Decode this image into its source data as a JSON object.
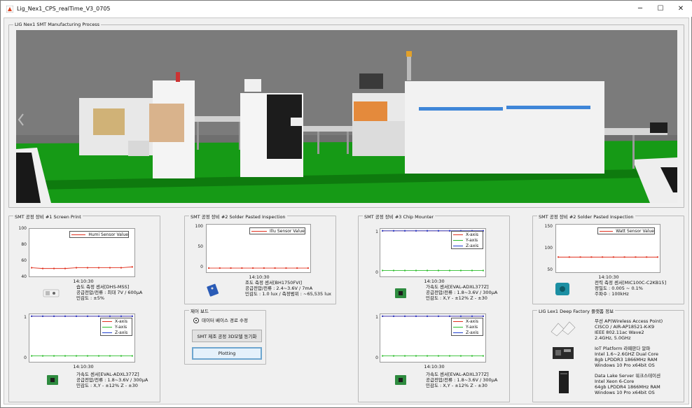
{
  "window": {
    "title": "Lig_Nex1_CPS_realTime_V3_0705",
    "minimize": "─",
    "maximize": "☐",
    "close": "✕"
  },
  "process": {
    "title": "LIG Nex1 SMT Manufacturing Process"
  },
  "panel1": {
    "title": "SMT 공정 장비 #1 Screen Print",
    "chart1": {
      "yticks": [
        "100",
        "80",
        "60",
        "40"
      ],
      "legend": "Humi Sensor Value",
      "time": "14:10:30"
    },
    "sensor1": [
      "습도 측정 센서[DHS-MSS]",
      "공급전압/전류 : 최대 7V / 600μA",
      "민감도 : ±5%"
    ],
    "chart2": {
      "yticks": [
        "1",
        "0"
      ],
      "legend": [
        "X-axis",
        "Y-axis",
        "Z-axis"
      ],
      "time": "14:10:30"
    },
    "sensor2": [
      "가속도 센서[EVAL-ADXL377Z]",
      "공급전압/전류 : 1.8~3.6V / 300μA",
      "민감도 : X,Y - ±12% Z - ±30"
    ]
  },
  "panel2": {
    "title": "SMT 공정 장비 #2 Solder Pasted Inspection",
    "chart1": {
      "yticks": [
        "100",
        "50",
        "0"
      ],
      "legend": "Illu Sensor Value",
      "time": "14:10:30"
    },
    "sensor1": [
      "조도 측정 센서[BH1750FVI]",
      "공급전압/전류 : 2.4~3.6V / 7mA",
      "민감도 : 1.0 lux / 측정범위 : ~65,535 lux"
    ]
  },
  "control": {
    "title": "제어 보드",
    "radio_label": "데이터 베이스 경로 수정",
    "sync_button": "SMT 제조 공정 3D모델 동기화",
    "plot_button": "Plotting"
  },
  "panel3": {
    "title": "SMT 공정 장비 #3 Chip Mounter",
    "chart1": {
      "yticks": [
        "1",
        "0"
      ],
      "legend": [
        "X-axis",
        "Y-axis",
        "Z-axis"
      ],
      "time": "14:10:30"
    },
    "sensor1": [
      "가속도 센서[EVAL-ADXL377Z]",
      "공급전압/전류 : 1.8~3.6V / 300μA",
      "민감도 : X,Y - ±12% Z - ±30"
    ],
    "chart2": {
      "yticks": [
        "1",
        "0"
      ],
      "legend": [
        "X-axis",
        "Y-axis",
        "Z-axis"
      ],
      "time": "14:10:30"
    },
    "sensor2": [
      "가속도 센서[EVAL-ADXL377Z]",
      "공급전압/전류 : 1.8~3.6V / 300μA",
      "민감도 : X,Y - ±12% Z - ±30"
    ]
  },
  "panel4": {
    "title": "SMT 공정 장비 #2 Solder Pasted Inspection",
    "chart1": {
      "yticks": [
        "150",
        "100",
        "50"
      ],
      "legend": "Watt Sensor Value",
      "time": "14:10:30"
    },
    "sensor1": [
      "전력 측정 센서[MIC100C-C2KB15]",
      "정밀도 : 0.005 ~ 0.1%",
      "주파수 : 100kHz"
    ]
  },
  "platform": {
    "title": "LIG Lex1 Deep Factory 플랫폼 정보",
    "ap": [
      "무선 AP(Wireless Access Point)",
      "CISCO / AIR-AP18521-K-K9",
      "IEEE 802.11ac Wave2",
      "2.4GHz, 5.0GHz"
    ],
    "iot": [
      "IoT Platform 라떼판다 알파",
      "Intel 1.6~2.6GHZ Dual Core",
      "8gb LPDDR3 1866MHz RAM",
      "Windows 10 Pro x64bit OS"
    ],
    "lake": [
      "Data Lake Server 워크스테이션",
      "Intel Xeon 6-Core",
      "64gb LPDDR4 1866MHz RAM",
      "Windows 10 Pro x64bit OS"
    ]
  },
  "chart_data": [
    {
      "type": "line",
      "title": "",
      "ylim": [
        40,
        100
      ],
      "x": [
        0,
        1,
        2,
        3,
        4,
        5,
        6,
        7,
        8,
        9
      ],
      "series": [
        {
          "name": "Humi Sensor Value",
          "color": "#e0301e",
          "values": [
            51,
            50,
            50,
            50,
            51,
            51,
            51,
            51,
            51,
            52
          ]
        }
      ]
    },
    {
      "type": "line",
      "title": "",
      "ylim": [
        -0.15,
        1.05
      ],
      "x": [
        0,
        1,
        2,
        3,
        4,
        5,
        6,
        7,
        8,
        9
      ],
      "series": [
        {
          "name": "X-axis",
          "color": "#e0301e",
          "values": [
            1,
            1,
            1,
            1,
            1,
            1,
            1,
            1,
            1,
            1
          ]
        },
        {
          "name": "Y-axis",
          "color": "#2bbd2b",
          "values": [
            0,
            0,
            0,
            0,
            0,
            0,
            0,
            0,
            0,
            0
          ]
        },
        {
          "name": "Z-axis",
          "color": "#1f3fd0",
          "values": [
            1,
            1,
            1,
            1,
            1,
            1,
            1,
            1,
            1,
            1
          ]
        }
      ]
    },
    {
      "type": "line",
      "title": "",
      "ylim": [
        -10,
        105
      ],
      "x": [
        0,
        1,
        2,
        3,
        4,
        5,
        6,
        7,
        8,
        9
      ],
      "series": [
        {
          "name": "Illu Sensor Value",
          "color": "#e0301e",
          "values": [
            0,
            0,
            0,
            0,
            0,
            0,
            0,
            0,
            0,
            0
          ]
        }
      ]
    },
    {
      "type": "line",
      "title": "",
      "ylim": [
        -0.15,
        1.05
      ],
      "x": [
        0,
        1,
        2,
        3,
        4,
        5,
        6,
        7,
        8,
        9
      ],
      "series": [
        {
          "name": "X-axis",
          "color": "#e0301e",
          "values": [
            1,
            1,
            1,
            1,
            1,
            1,
            1,
            1,
            1,
            1
          ]
        },
        {
          "name": "Y-axis",
          "color": "#2bbd2b",
          "values": [
            0,
            0,
            0,
            0,
            0,
            0,
            0,
            0,
            0,
            0
          ]
        },
        {
          "name": "Z-axis",
          "color": "#1f3fd0",
          "values": [
            1,
            1,
            1,
            1,
            1,
            1,
            1,
            1,
            1,
            1
          ]
        }
      ]
    },
    {
      "type": "line",
      "title": "",
      "ylim": [
        -0.15,
        1.05
      ],
      "x": [
        0,
        1,
        2,
        3,
        4,
        5,
        6,
        7,
        8,
        9
      ],
      "series": [
        {
          "name": "X-axis",
          "color": "#e0301e",
          "values": [
            1,
            1,
            1,
            1,
            1,
            1,
            1,
            1,
            1,
            1
          ]
        },
        {
          "name": "Y-axis",
          "color": "#2bbd2b",
          "values": [
            0,
            0,
            0,
            0,
            0,
            0,
            0,
            0,
            0,
            0
          ]
        },
        {
          "name": "Z-axis",
          "color": "#1f3fd0",
          "values": [
            1,
            1,
            1,
            1,
            1,
            1,
            1,
            1,
            1,
            1
          ]
        }
      ]
    },
    {
      "type": "line",
      "title": "",
      "ylim": [
        50,
        160
      ],
      "x": [
        0,
        1,
        2,
        3,
        4,
        5,
        6,
        7,
        8,
        9
      ],
      "series": [
        {
          "name": "Watt Sensor Value",
          "color": "#e0301e",
          "values": [
            85,
            85,
            85,
            85,
            85,
            85,
            85,
            85,
            85,
            85
          ]
        }
      ]
    }
  ]
}
